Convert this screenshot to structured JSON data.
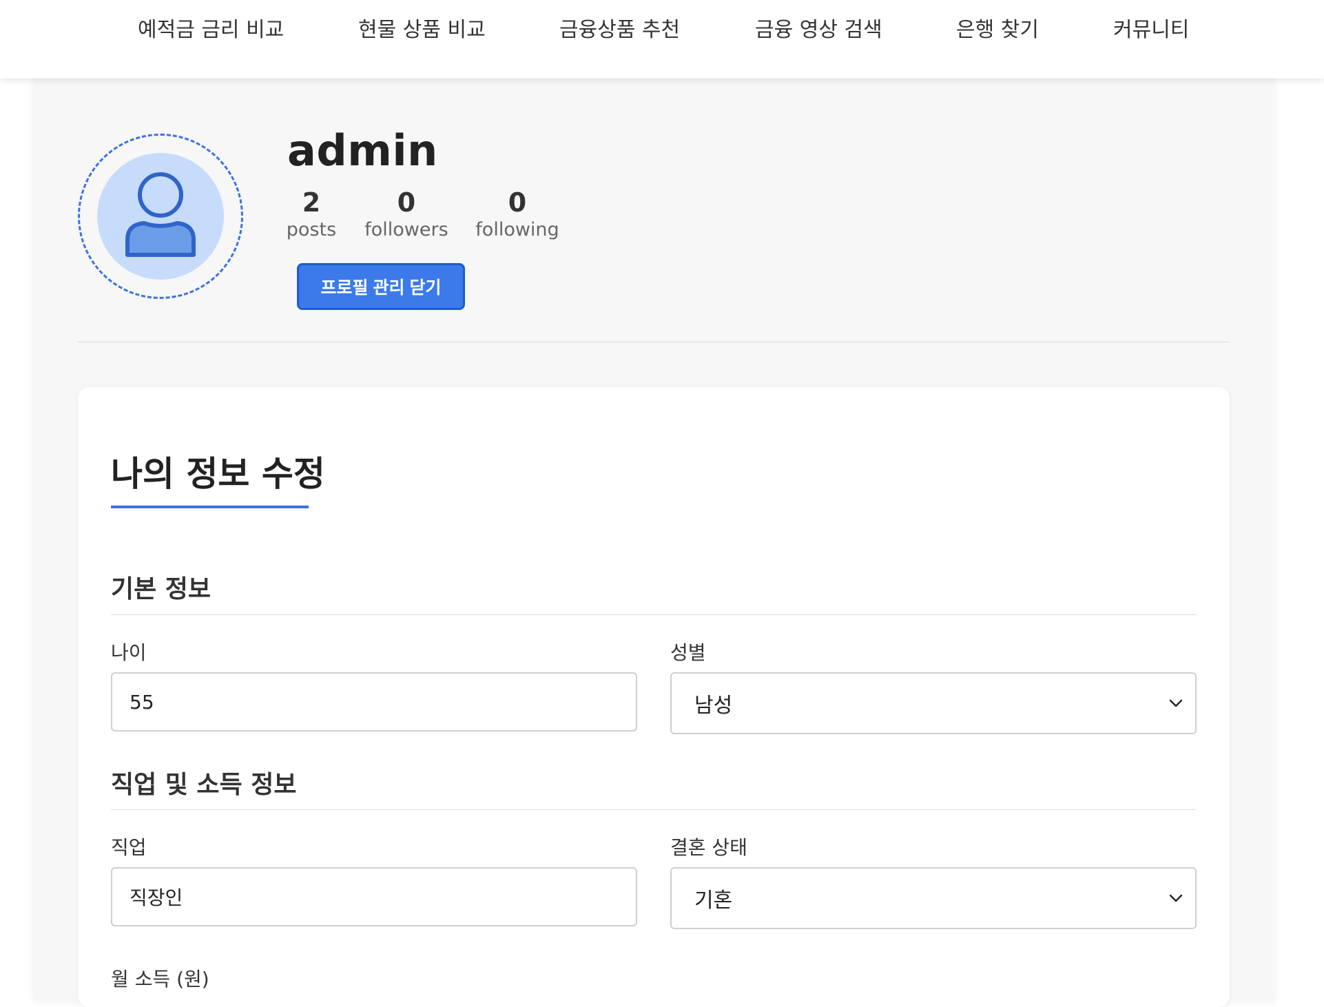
{
  "nav": {
    "items": [
      {
        "label": "예적금 금리 비교"
      },
      {
        "label": "현물 상품 비교"
      },
      {
        "label": "금융상품 추천"
      },
      {
        "label": "금융 영상 검색"
      },
      {
        "label": "은행 찾기"
      },
      {
        "label": "커뮤니티"
      }
    ]
  },
  "profile": {
    "username": "admin",
    "stats": [
      {
        "value": "2",
        "label": "posts"
      },
      {
        "value": "0",
        "label": "followers"
      },
      {
        "value": "0",
        "label": "following"
      }
    ],
    "toggle_button": "프로필 관리 닫기",
    "avatar_icon": "user-icon"
  },
  "form": {
    "title": "나의 정보 수정",
    "sections": {
      "basic": {
        "title": "기본 정보",
        "age_label": "나이",
        "age_value": "55",
        "gender_label": "성별",
        "gender_value": "남성"
      },
      "job": {
        "title": "직업 및 소득 정보",
        "job_label": "직업",
        "job_value": "직장인",
        "marital_label": "결혼 상태",
        "marital_value": "기혼",
        "income_label": "월 소득 (원)"
      }
    }
  },
  "colors": {
    "accent": "#3b7ae8",
    "avatar_bg": "#c7dcfb",
    "page_bg": "#f7f7f7"
  }
}
